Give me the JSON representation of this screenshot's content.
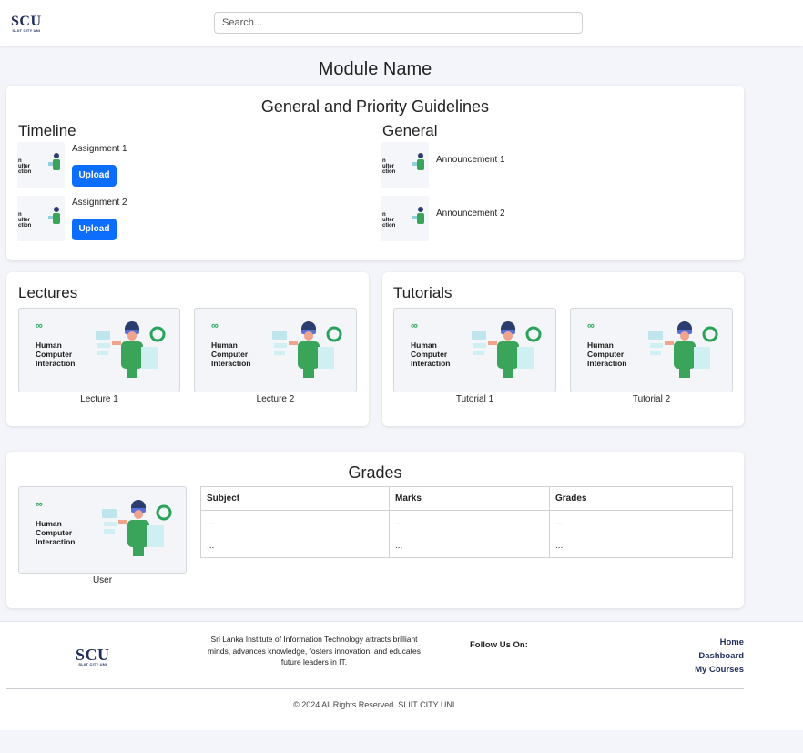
{
  "header": {
    "logo_text": "SCU",
    "logo_subtext": "SLIIT CITY UNI",
    "search_placeholder": "Search..."
  },
  "page_title": "Module Name",
  "guidelines": {
    "title": "General and Priority Guidelines",
    "timeline": {
      "title": "Timeline",
      "items": [
        {
          "label": "Assignment 1",
          "button": "Upload"
        },
        {
          "label": "Assignment 2",
          "button": "Upload"
        }
      ]
    },
    "general": {
      "title": "General",
      "items": [
        {
          "label": "Announcement 1"
        },
        {
          "label": "Announcement 2"
        }
      ]
    }
  },
  "lectures": {
    "title": "Lectures",
    "items": [
      {
        "caption": "Lecture 1"
      },
      {
        "caption": "Lecture 2"
      }
    ]
  },
  "tutorials": {
    "title": "Tutorials",
    "items": [
      {
        "caption": "Tutorial 1"
      },
      {
        "caption": "Tutorial 2"
      }
    ]
  },
  "thumbnail": {
    "brand_glyph": "∞",
    "line1": "Human",
    "line2": "Computer",
    "line3": "Interaction",
    "small_text": "n\nulter\nction"
  },
  "grades": {
    "title": "Grades",
    "user_caption": "User",
    "columns": [
      "Subject",
      "Marks",
      "Grades"
    ],
    "rows": [
      [
        "...",
        "...",
        "..."
      ],
      [
        "...",
        "...",
        "..."
      ]
    ]
  },
  "footer": {
    "description": "Sri Lanka Institute of Information Technology attracts brilliant minds, advances knowledge, fosters innovation, and educates future leaders in IT.",
    "follow_label": "Follow Us On:",
    "links": [
      "Home",
      "Dashboard",
      "My Courses"
    ],
    "copyright": "© 2024 All Rights Reserved. SLIIT CITY UNI."
  },
  "colors": {
    "primary_button": "#0d6efd",
    "brand_navy": "#1f2d5c",
    "brand_green": "#2aa35a"
  }
}
